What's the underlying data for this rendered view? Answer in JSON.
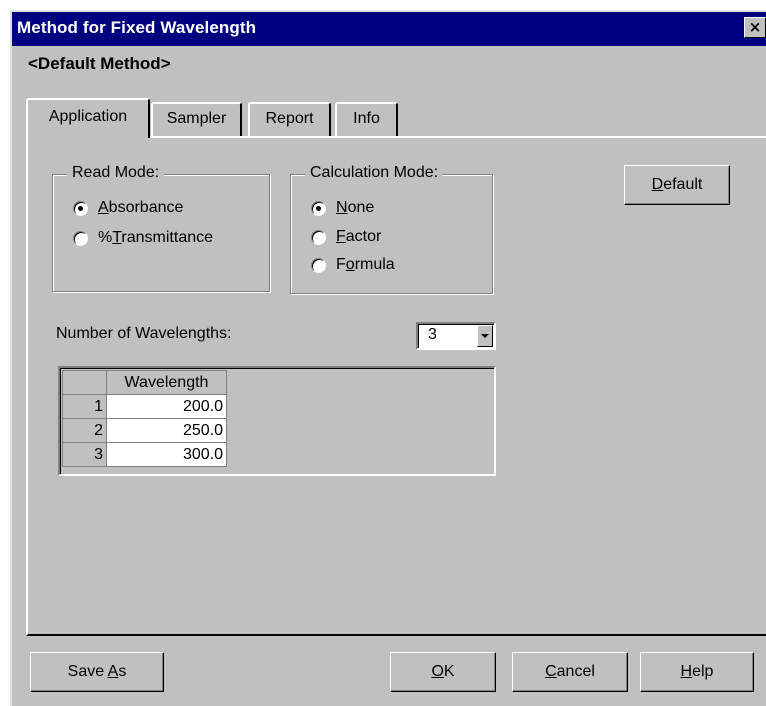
{
  "window": {
    "title": "Method for Fixed Wavelength",
    "close_label": "×"
  },
  "method_name": "<Default Method>",
  "tabs": [
    {
      "label": "Application",
      "active": true
    },
    {
      "label": "Sampler",
      "active": false
    },
    {
      "label": "Report",
      "active": false
    },
    {
      "label": "Info",
      "active": false
    }
  ],
  "read_mode": {
    "label": "Read Mode:",
    "options": [
      {
        "prefix": "",
        "mnemonic": "A",
        "suffix": "bsorbance",
        "selected": true
      },
      {
        "prefix": "%",
        "mnemonic": "T",
        "suffix": "ransmittance",
        "selected": false
      }
    ]
  },
  "calculation_mode": {
    "label": "Calculation Mode:",
    "options": [
      {
        "prefix": "",
        "mnemonic": "N",
        "suffix": "one",
        "selected": true
      },
      {
        "prefix": "",
        "mnemonic": "F",
        "suffix": "actor",
        "selected": false
      },
      {
        "prefix": "F",
        "mnemonic": "o",
        "suffix": "rmula",
        "selected": false
      }
    ]
  },
  "default_button": {
    "mnemonic": "D",
    "rest": "efault"
  },
  "number_of_wavelengths": {
    "label": "Number of Wavelengths:",
    "value": "3"
  },
  "wavelength_table": {
    "header": "Wavelength",
    "rows": [
      {
        "index": "1",
        "value": "200.0"
      },
      {
        "index": "2",
        "value": "250.0"
      },
      {
        "index": "3",
        "value": "300.0"
      }
    ]
  },
  "buttons": {
    "save_as": {
      "prefix": "Save ",
      "mnemonic": "A",
      "suffix": "s"
    },
    "ok": {
      "mnemonic": "O",
      "suffix": "K"
    },
    "cancel": {
      "mnemonic": "C",
      "suffix": "ancel"
    },
    "help": {
      "mnemonic": "H",
      "suffix": "elp"
    }
  }
}
